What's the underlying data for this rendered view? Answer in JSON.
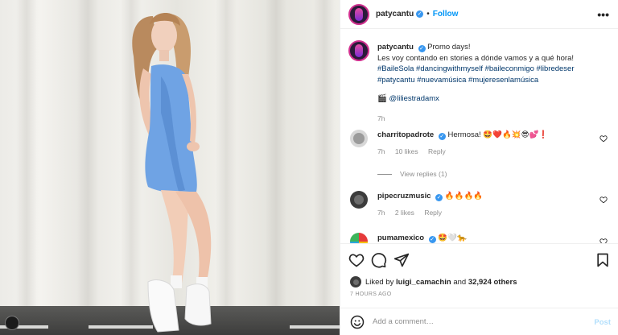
{
  "header": {
    "username": "patycantu",
    "verified_icon": "verified-badge-icon",
    "separator": "•",
    "follow_label": "Follow",
    "more_icon": "more-horizontal-icon"
  },
  "caption": {
    "username": "patycantu",
    "line1": "Promo days!",
    "line2": "Les voy contando en stories a dónde vamos y a qué hora!",
    "hashtags_line1": "#BaileSola #dancingwithmyself #baileconmigo #libredeser",
    "hashtags_line2": "#patycantu #nuevamúsica #mujeresenlamúsica",
    "credit_emoji": "🎬",
    "credit_handle": "@liliestradamx",
    "time": "7h"
  },
  "comments": [
    {
      "username": "charritopadrote",
      "text": "Hermosa! 🤩❤️🔥💥😎💕❗",
      "time": "7h",
      "likes": "10 likes",
      "reply": "Reply",
      "view_replies": "View replies (1)"
    },
    {
      "username": "pipecruzmusic",
      "text": "🔥🔥🔥🔥",
      "time": "7h",
      "likes": "2 likes",
      "reply": "Reply"
    },
    {
      "username": "pumamexico",
      "text": "🤩🤍🐆",
      "time": "",
      "likes": "",
      "reply": ""
    }
  ],
  "actions": {
    "like_icon": "heart-outline-icon",
    "comment_icon": "comment-icon",
    "share_icon": "paper-plane-icon",
    "save_icon": "bookmark-icon"
  },
  "likes": {
    "prefix": "Liked by",
    "user": "luigi_camachin",
    "joiner": "and",
    "others": "32,924 others"
  },
  "timeago": "7 HOURS AGO",
  "add_comment": {
    "emoji_icon": "emoji-smile-icon",
    "placeholder": "Add a comment…",
    "post_label": "Post"
  },
  "colors": {
    "accent": "#0095f6",
    "verified": "#3897f0",
    "dress": "#6fa3e4"
  }
}
